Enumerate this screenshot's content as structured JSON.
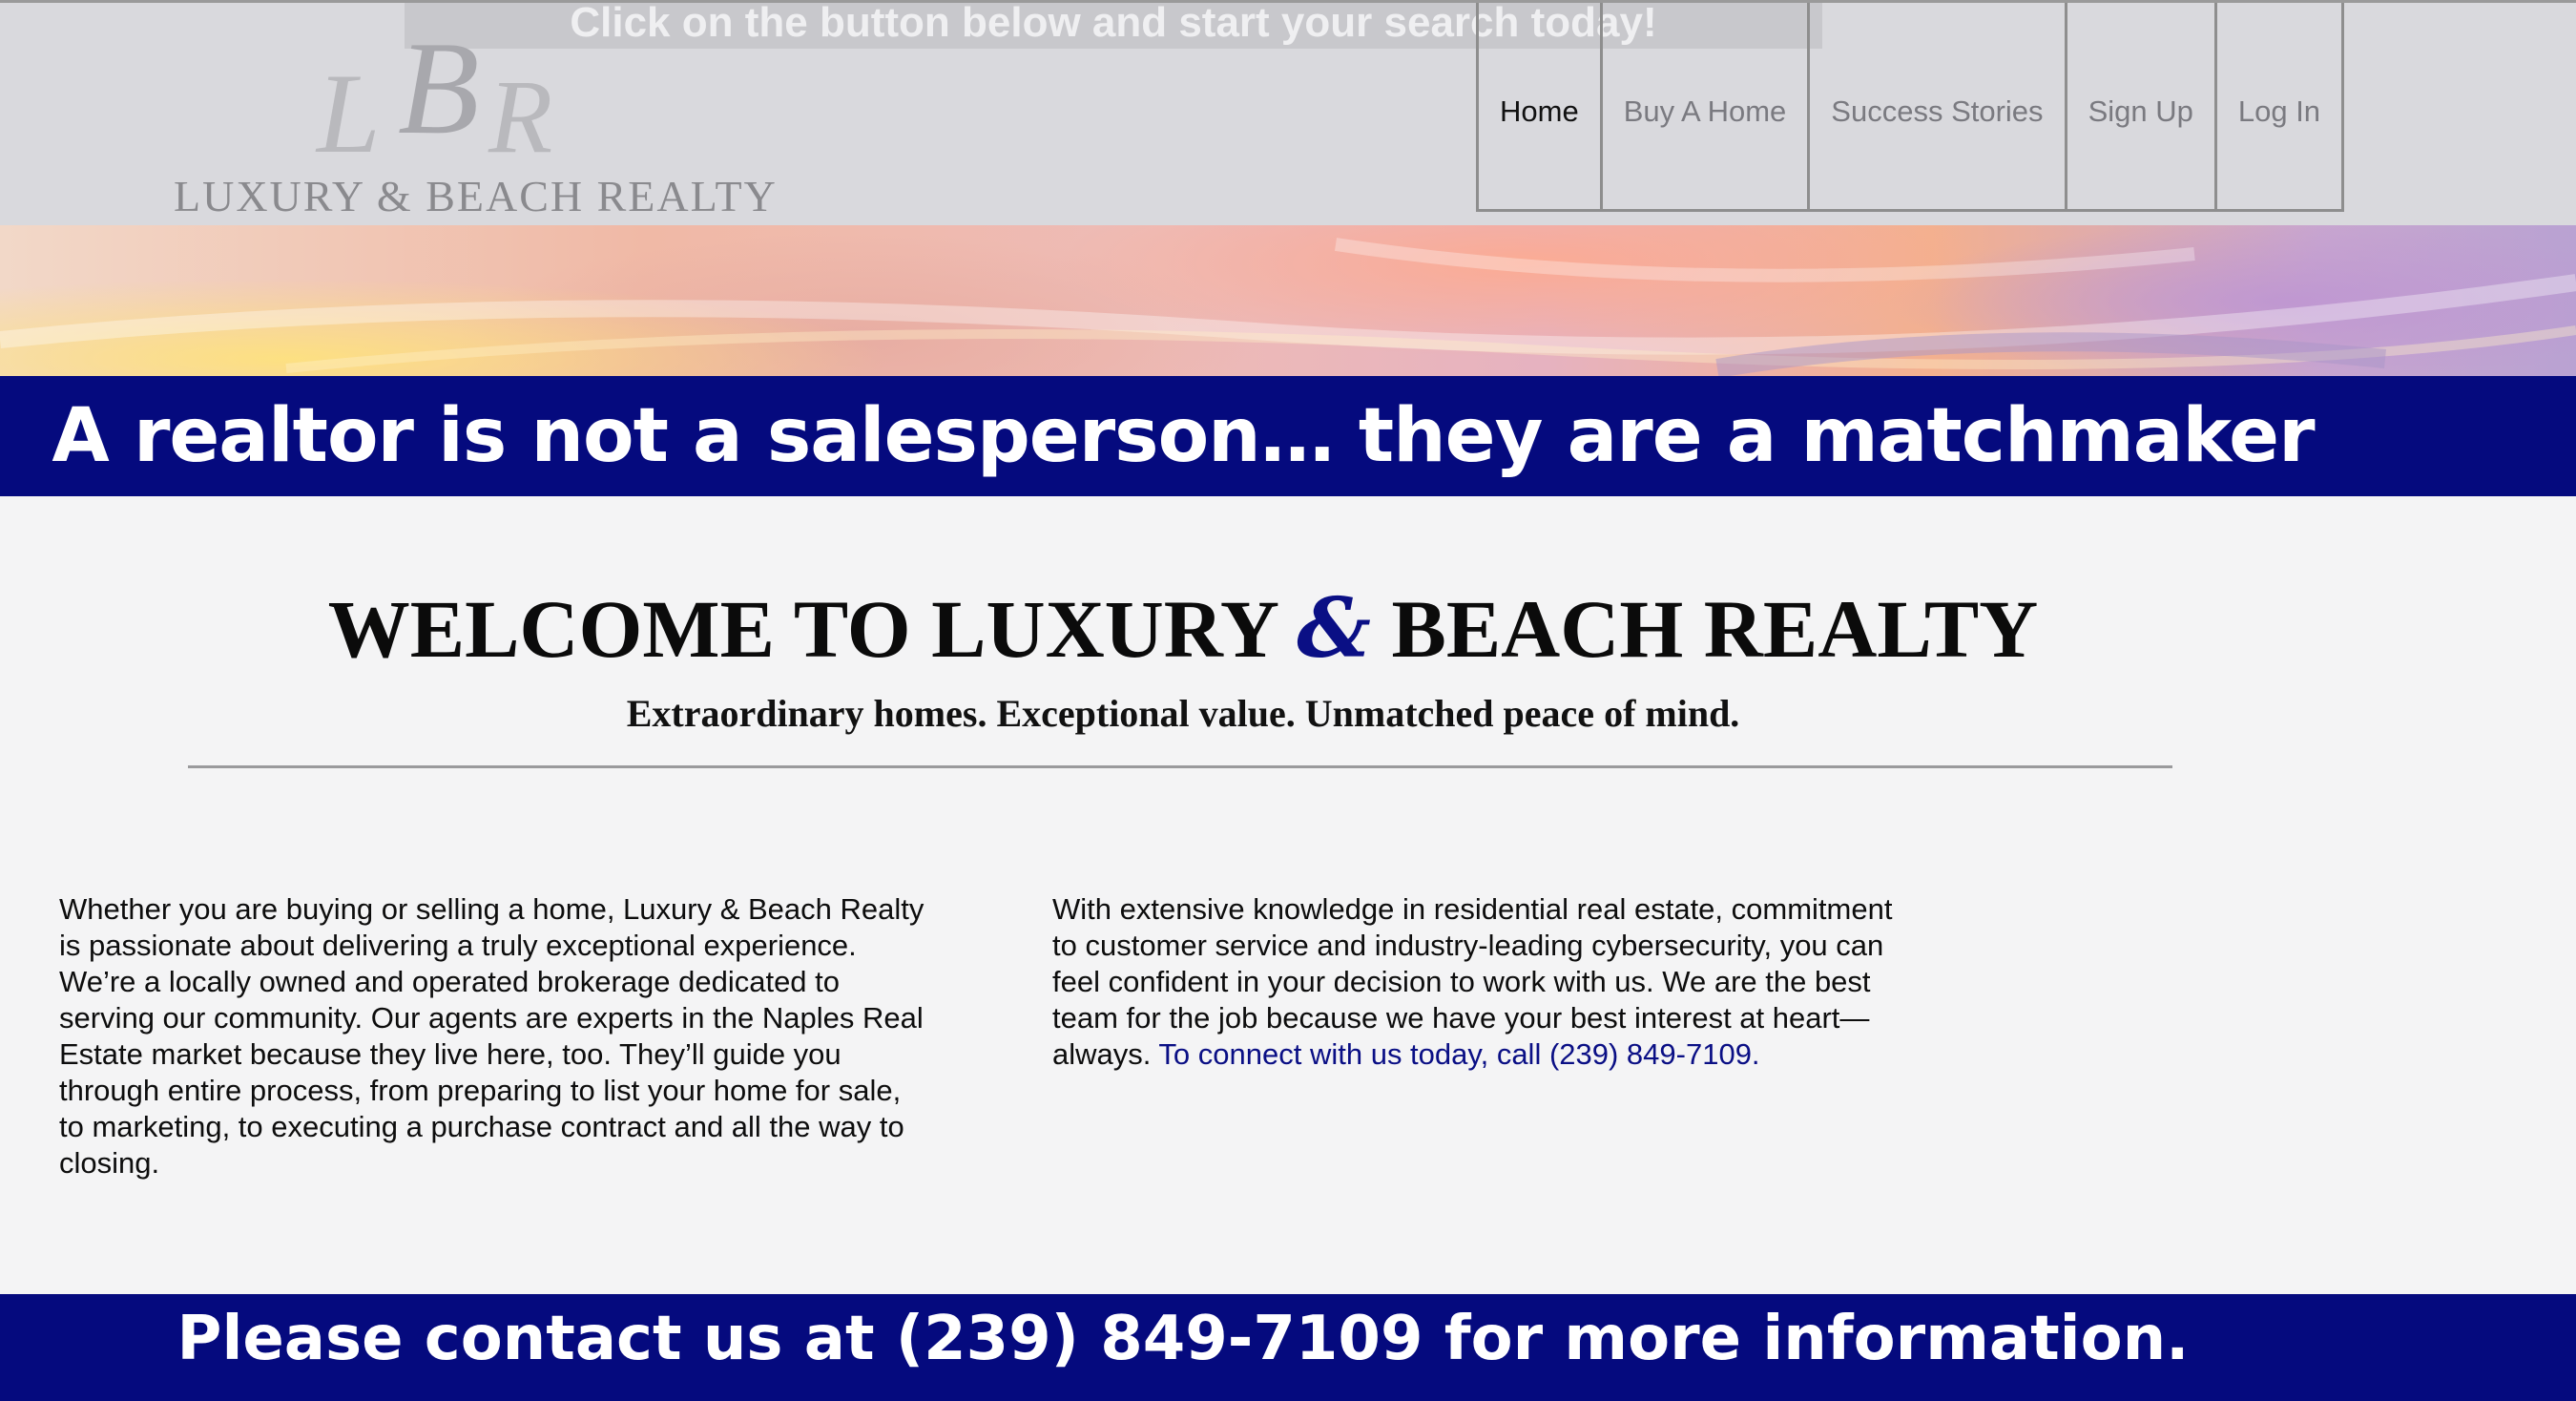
{
  "header": {
    "search_banner": "Click on the button below and start your search today!",
    "logo": {
      "monogram": "LBR",
      "name": "LUXURY & BEACH REALTY"
    },
    "nav": [
      {
        "label": "Home",
        "active": true
      },
      {
        "label": "Buy A Home",
        "active": false
      },
      {
        "label": "Success Stories",
        "active": false
      },
      {
        "label": "Sign Up",
        "active": false
      },
      {
        "label": "Log In",
        "active": false
      }
    ]
  },
  "tagline": "A realtor is not a salesperson… they are a matchmaker",
  "welcome": {
    "title_before": "WELCOME TO LUXURY ",
    "title_amp": "&",
    "title_after": " BEACH REALTY",
    "subtitle": "Extraordinary homes. Exceptional value. Unmatched peace of mind."
  },
  "body": {
    "left": [
      "Whether you are buying or selling a home, Luxury & Beach Realty",
      "is passionate about delivering a truly exceptional experience.",
      "We’re a locally owned and operated brokerage dedicated to",
      "serving our community. Our agents are experts in the Naples Real",
      "Estate market because they live here, too. They’ll guide you",
      "through entire process, from preparing to list your home for sale,",
      "to marketing, to executing a purchase contract and all the way to",
      "closing."
    ],
    "right": [
      "With extensive knowledge in residential real estate, commitment",
      "to customer service and industry-leading cybersecurity, you can",
      "feel confident in your decision to work with us. We are the best",
      "team for the job because we have your best interest at heart—"
    ],
    "right_last_prefix": "always. ",
    "right_link": "To connect with us today, call (239) 849-7109."
  },
  "footer": {
    "text": "Please contact us at (239) 849-7109 for more information."
  },
  "colors": {
    "brand_navy": "#050a7e",
    "link": "#0a0f85",
    "header_bg": "#d9d9dd",
    "page_bg": "#f4f4f5"
  }
}
